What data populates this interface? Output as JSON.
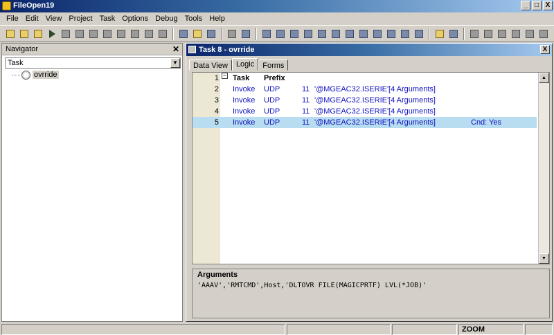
{
  "app": {
    "title": "FileOpen19"
  },
  "window_controls": {
    "minimize": "_",
    "maximize": "□",
    "close": "X"
  },
  "menu": [
    "File",
    "Edit",
    "View",
    "Project",
    "Task",
    "Options",
    "Debug",
    "Tools",
    "Help"
  ],
  "navigator": {
    "title": "Navigator",
    "close": "✕",
    "combo_value": "Task",
    "tree_item": "ovrride"
  },
  "task_window": {
    "title": "Task 8 -   ovrride",
    "close": "X",
    "tabs": [
      "Data View",
      "Logic",
      "Forms"
    ],
    "active_tab": "Logic",
    "header": {
      "num": "1",
      "task": "Task",
      "prefix": "Prefix"
    },
    "rows": [
      {
        "num": "2",
        "op": "Invoke",
        "type": "UDP",
        "n": "11",
        "expr": "'@MGEAC32.ISERIE'[4 Arguments]",
        "cnd": ""
      },
      {
        "num": "3",
        "op": "Invoke",
        "type": "UDP",
        "n": "11",
        "expr": "'@MGEAC32.ISERIE'[4 Arguments]",
        "cnd": ""
      },
      {
        "num": "4",
        "op": "Invoke",
        "type": "UDP",
        "n": "11",
        "expr": "'@MGEAC32.ISERIE'[4 Arguments]",
        "cnd": ""
      },
      {
        "num": "5",
        "op": "Invoke",
        "type": "UDP",
        "n": "11",
        "expr": "'@MGEAC32.ISERIE'[4 Arguments]",
        "cnd": "Cnd: Yes"
      }
    ],
    "arguments_label": "Arguments",
    "arguments_text": "'AAAV','RMTCMD',Host,'DLTOVR FILE(MAGICPRTF) LVL(*JOB)'"
  },
  "statusbar": {
    "zoom": "ZOOM"
  },
  "colors": {
    "selected_row": "#b8dcf0",
    "code_text": "#1010c0",
    "title_bar": "#0a246a"
  }
}
